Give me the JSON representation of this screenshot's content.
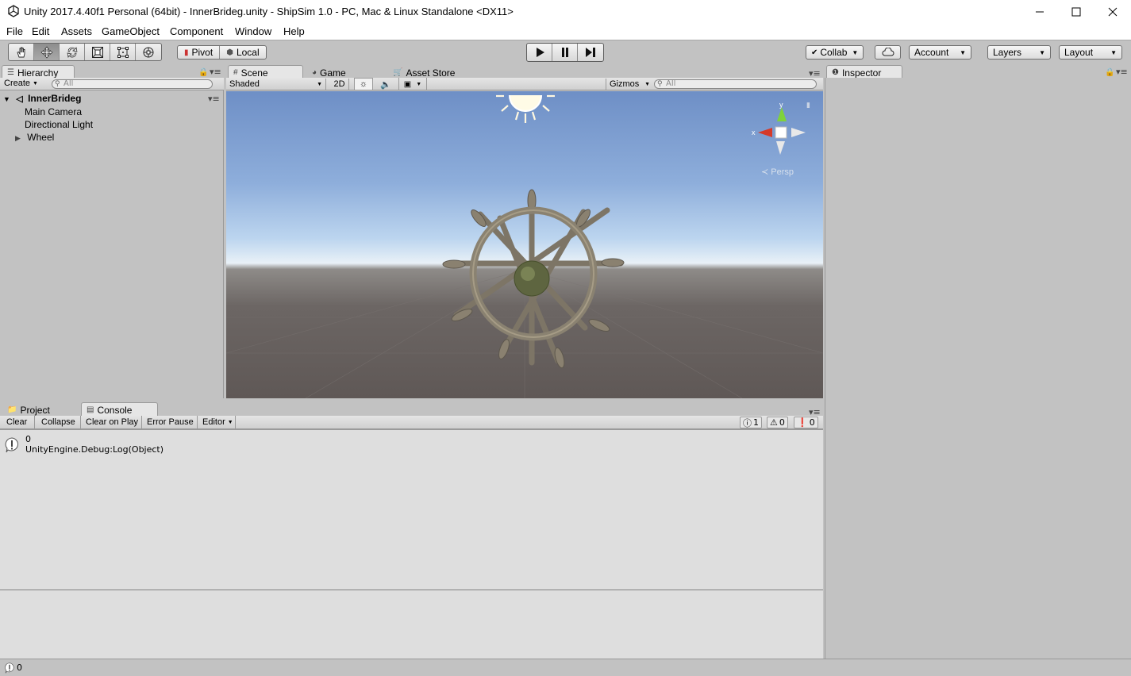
{
  "window": {
    "title": "Unity 2017.4.40f1 Personal (64bit) - InnerBrideg.unity - ShipSim 1.0 - PC, Mac & Linux Standalone <DX11>",
    "minimize_icon": "minimize-icon",
    "maximize_icon": "maximize-icon",
    "close_icon": "close-icon"
  },
  "menu": {
    "items": [
      "File",
      "Edit",
      "Assets",
      "GameObject",
      "Component",
      "Window",
      "Help"
    ]
  },
  "toolbar": {
    "tools": [
      "hand-tool",
      "move-tool",
      "rotate-tool",
      "scale-tool",
      "rect-tool",
      "transform-tool"
    ],
    "active_tool": "move-tool",
    "pivot_label": "Pivot",
    "local_label": "Local",
    "collab_label": "Collab",
    "account_label": "Account",
    "layers_label": "Layers",
    "layout_label": "Layout"
  },
  "hierarchy": {
    "tab_label": "Hierarchy",
    "create_label": "Create",
    "search_placeholder": "All",
    "scene_name": "InnerBrideg",
    "items": [
      "Main Camera",
      "Directional Light",
      "Wheel"
    ]
  },
  "scene": {
    "tabs": [
      "Scene",
      "Game",
      "Asset Store"
    ],
    "shading_mode": "Shaded",
    "mode_2d_label": "2D",
    "gizmos_label": "Gizmos",
    "search_placeholder": "All",
    "projection_label": "Persp",
    "gizmo_axis_x": "x",
    "gizmo_axis_y": "y"
  },
  "inspector": {
    "tab_label": "Inspector"
  },
  "console": {
    "tabs": [
      "Project",
      "Console"
    ],
    "buttons": {
      "clear": "Clear",
      "collapse": "Collapse",
      "clear_on_play": "Clear on Play",
      "error_pause": "Error Pause",
      "editor": "Editor"
    },
    "counts": {
      "log": "1",
      "warning": "0",
      "error": "0"
    },
    "entry": {
      "line1": "0",
      "line2": "UnityEngine.Debug:Log(Object)"
    }
  },
  "status": {
    "message": "0"
  }
}
